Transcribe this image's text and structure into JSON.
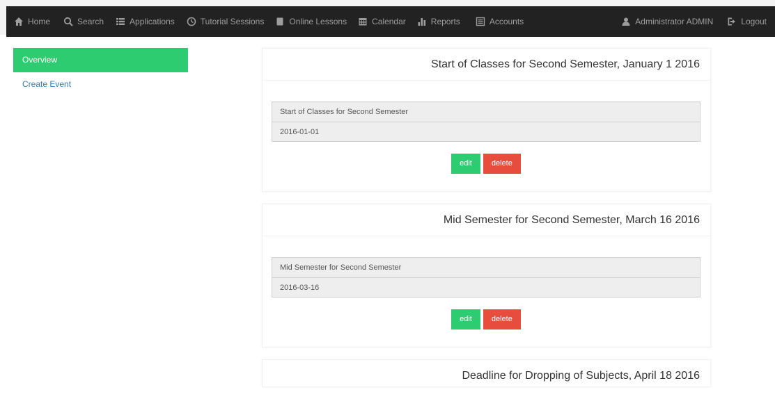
{
  "nav": {
    "left": [
      {
        "label": "Home",
        "icon": "home-icon"
      },
      {
        "label": "Search",
        "icon": "search-icon"
      },
      {
        "label": "Applications",
        "icon": "list-icon"
      },
      {
        "label": "Tutorial Sessions",
        "icon": "clock-icon"
      },
      {
        "label": "Online Lessons",
        "icon": "book-icon"
      },
      {
        "label": "Calendar",
        "icon": "calendar-icon"
      },
      {
        "label": "Reports",
        "icon": "bar-chart-icon"
      },
      {
        "label": "Accounts",
        "icon": "accounts-icon"
      }
    ],
    "right": [
      {
        "label": "Administrator ADMIN",
        "icon": "user-icon"
      },
      {
        "label": "Logout",
        "icon": "logout-icon"
      }
    ]
  },
  "sidebar": {
    "items": [
      {
        "label": "Overview"
      },
      {
        "label": "Create Event"
      }
    ]
  },
  "events": [
    {
      "title": "Start of Classes for Second Semester, January 1 2016",
      "name": "Start of Classes for Second Semester",
      "date": "2016-01-01",
      "edit": "edit",
      "delete": "delete"
    },
    {
      "title": "Mid Semester for Second Semester, March 16 2016",
      "name": "Mid Semester for Second Semester",
      "date": "2016-03-16",
      "edit": "edit",
      "delete": "delete"
    },
    {
      "title": "Deadline for Dropping of Subjects, April 18 2016"
    }
  ],
  "colors": {
    "accent_green": "#2ecc71",
    "danger_red": "#e74c3c",
    "navbar_bg": "#222222"
  }
}
